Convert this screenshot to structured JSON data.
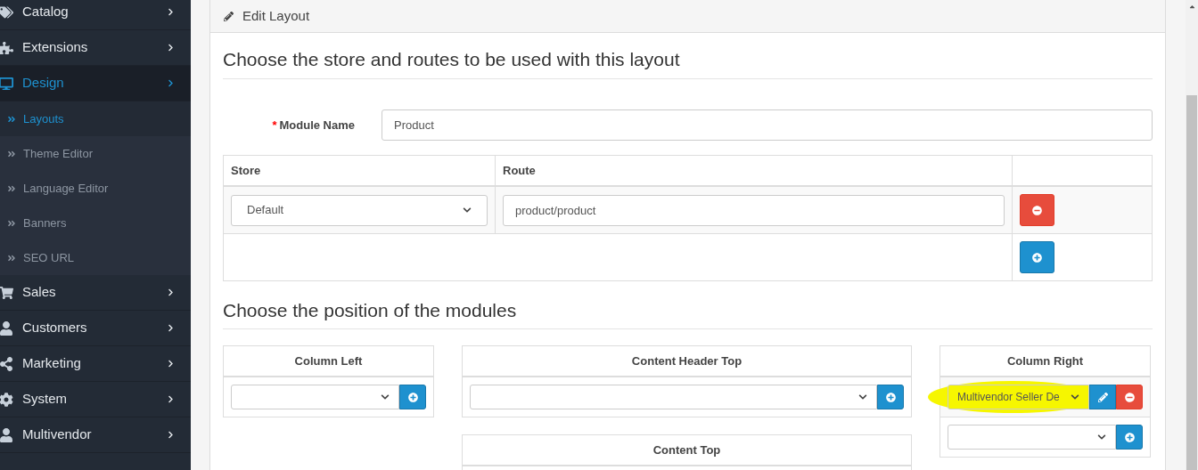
{
  "sidebar": {
    "items": [
      {
        "label": "Catalog",
        "selected": false
      },
      {
        "label": "Extensions",
        "selected": false
      },
      {
        "label": "Design",
        "selected": true,
        "children": [
          {
            "label": "Layouts",
            "selected": true
          },
          {
            "label": "Theme Editor",
            "selected": false
          },
          {
            "label": "Language Editor",
            "selected": false
          },
          {
            "label": "Banners",
            "selected": false
          },
          {
            "label": "SEO URL",
            "selected": false
          }
        ]
      },
      {
        "label": "Sales",
        "selected": false
      },
      {
        "label": "Customers",
        "selected": false
      },
      {
        "label": "Marketing",
        "selected": false
      },
      {
        "label": "System",
        "selected": false
      },
      {
        "label": "Multivendor",
        "selected": false
      }
    ]
  },
  "panel": {
    "title": "Edit Layout",
    "section_1": {
      "heading": "Choose the store and routes to be used with this layout"
    },
    "module_name": {
      "label": "Module Name",
      "required_mark": "*",
      "value": "Product"
    },
    "routes_table": {
      "columns": [
        "Store",
        "Route"
      ],
      "rows": [
        {
          "store": "Default",
          "route": "product/product"
        }
      ]
    },
    "section_2": {
      "heading": "Choose the position of the modules"
    },
    "positions": [
      {
        "title": "Column Left"
      },
      {
        "title": "Content Header Top"
      },
      {
        "title": "Column Right",
        "modules": [
          {
            "value": "Multivendor Seller De",
            "highlighted": true
          }
        ]
      },
      {
        "title": "Content Top"
      }
    ]
  }
}
